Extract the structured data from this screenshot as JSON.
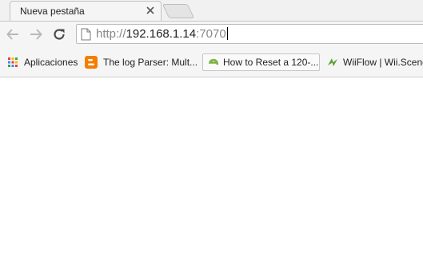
{
  "tab": {
    "title": "Nueva pestaña"
  },
  "omnibox": {
    "scheme": "http://",
    "host": "192.168.1.14",
    "port": ":7070"
  },
  "bookmarks": [
    {
      "label": "Aplicaciones",
      "icon": "apps-grid-icon"
    },
    {
      "label": "The log Parser: Mult...",
      "icon": "blogger-icon"
    },
    {
      "label": "How to Reset a 120-...",
      "icon": "site-e-icon"
    },
    {
      "label": "WiiFlow | Wii.Scene",
      "icon": "wiiflow-icon"
    }
  ]
}
